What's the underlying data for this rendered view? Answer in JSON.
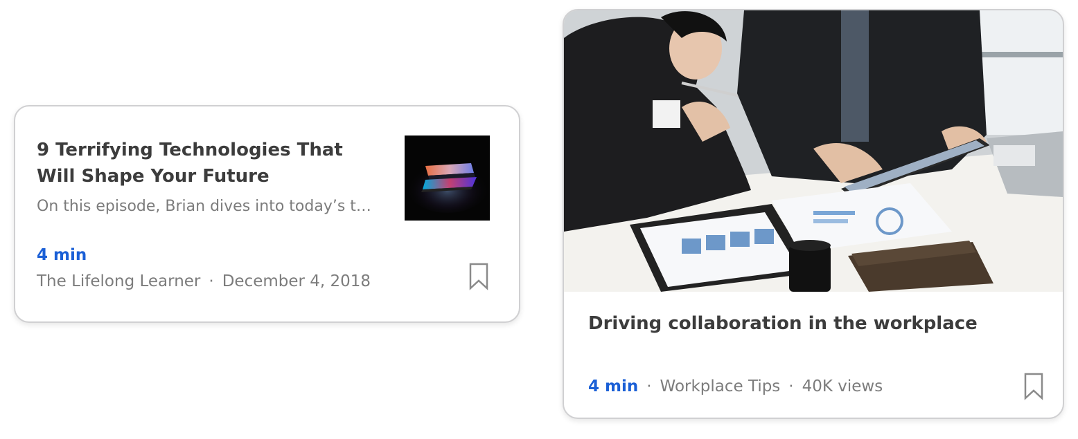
{
  "cards": [
    {
      "title": "9 Terrifying Technologies That Will Shape Your Future",
      "description": "On this episode, Brian dives into today’s t…",
      "duration": "4 min",
      "source": "The Lifelong Learner",
      "separator": "·",
      "date": "December 4, 2018",
      "thumbnail_icon": "laptop-glow-image",
      "bookmark_icon": "bookmark-icon"
    },
    {
      "title": "Driving collaboration in the workplace",
      "duration": "4 min",
      "separator": "·",
      "category": "Workplace Tips",
      "views": "40K views",
      "hero_icon": "business-meeting-photo",
      "bookmark_icon": "bookmark-icon"
    }
  ],
  "colors": {
    "accent": "#1a5fd6",
    "title": "#3c3c3c",
    "muted": "#7c7c7c",
    "border": "#d0d0d2"
  }
}
